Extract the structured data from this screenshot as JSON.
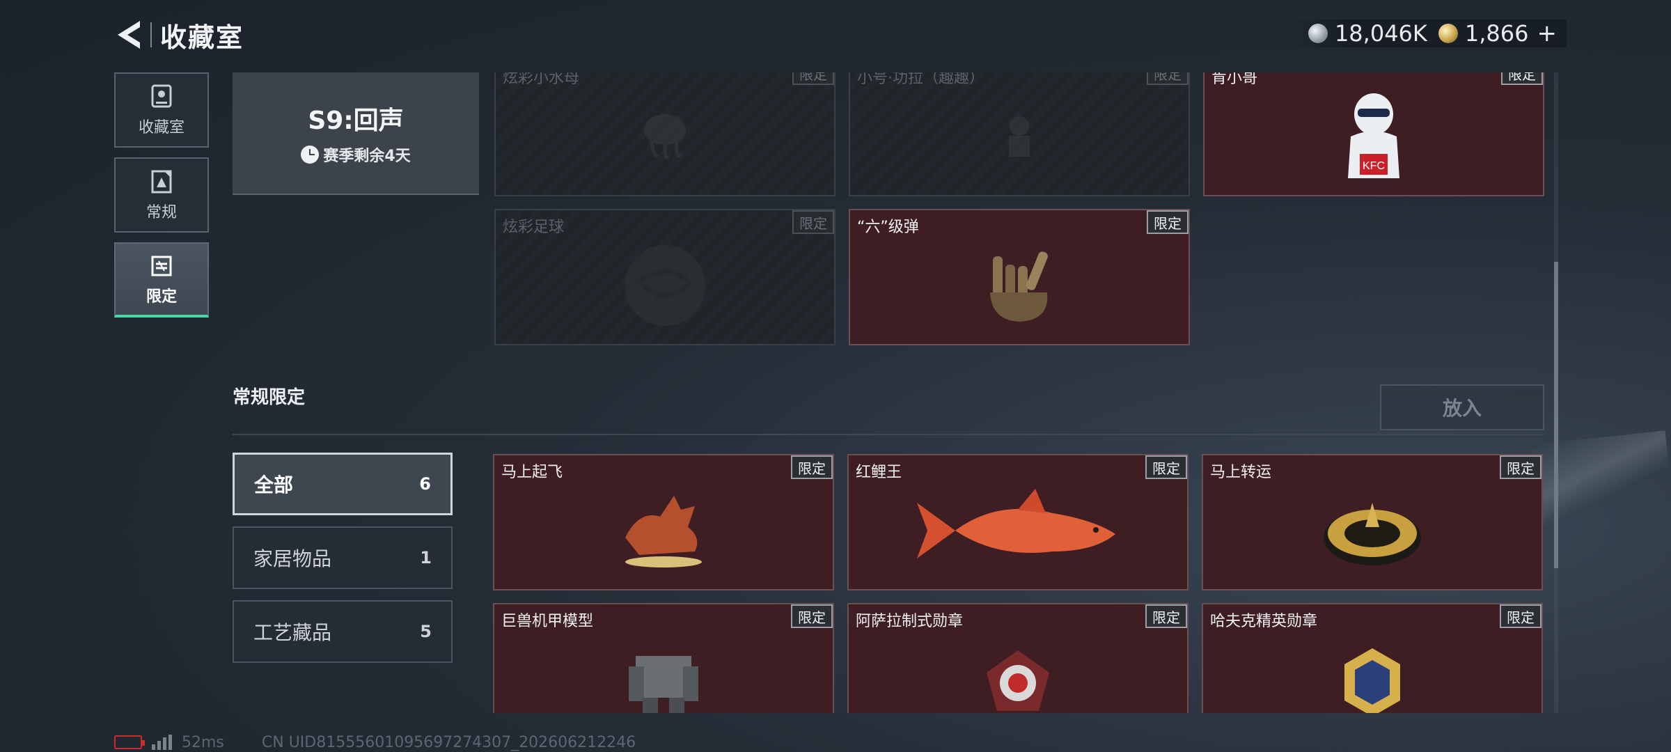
{
  "header": {
    "title": "收藏室",
    "currency": [
      {
        "icon": "silver-coin-icon",
        "value": "18,046K"
      },
      {
        "icon": "gold-coin-icon",
        "value": "1,866"
      }
    ],
    "plus": "+"
  },
  "nav": [
    {
      "label": "收藏室",
      "icon": "trophy-icon",
      "active": false
    },
    {
      "label": "常规",
      "icon": "regular-doc-icon",
      "active": false
    },
    {
      "label": "限定",
      "icon": "limited-ticket-icon",
      "active": true
    }
  ],
  "season": {
    "name": "S9:回声",
    "remaining": "赛季剩余4天"
  },
  "top_items": [
    {
      "name": "炫彩小水母",
      "badge": "限定",
      "locked": true
    },
    {
      "name": "小号·功拉（趣趣）",
      "badge": "限定",
      "locked": true
    },
    {
      "name": "肯小哥",
      "badge": "限定",
      "locked": false
    },
    {
      "name": "炫彩足球",
      "badge": "限定",
      "locked": true
    },
    {
      "name": "“六”级弹",
      "badge": "限定",
      "locked": false
    }
  ],
  "section": {
    "title": "常规限定",
    "put_button": "放入"
  },
  "filters": [
    {
      "label": "全部",
      "count": "6",
      "active": true
    },
    {
      "label": "家居物品",
      "count": "1",
      "active": false
    },
    {
      "label": "工艺藏品",
      "count": "5",
      "active": false
    }
  ],
  "items": [
    {
      "name": "马上起飞",
      "badge": "限定"
    },
    {
      "name": "红鲤王",
      "badge": "限定"
    },
    {
      "name": "马上转运",
      "badge": "限定"
    },
    {
      "name": "巨兽机甲模型",
      "badge": "限定"
    },
    {
      "name": "阿萨拉制式勋章",
      "badge": "限定"
    },
    {
      "name": "哈夫克精英勋章",
      "badge": "限定"
    }
  ],
  "footer": {
    "ping": "52ms",
    "uid": "CN UID8155560109569727430​7_202606212246"
  },
  "colors": {
    "accent": "#49d7a7",
    "card_bg": "#3f1e23",
    "background": "#242c36"
  }
}
